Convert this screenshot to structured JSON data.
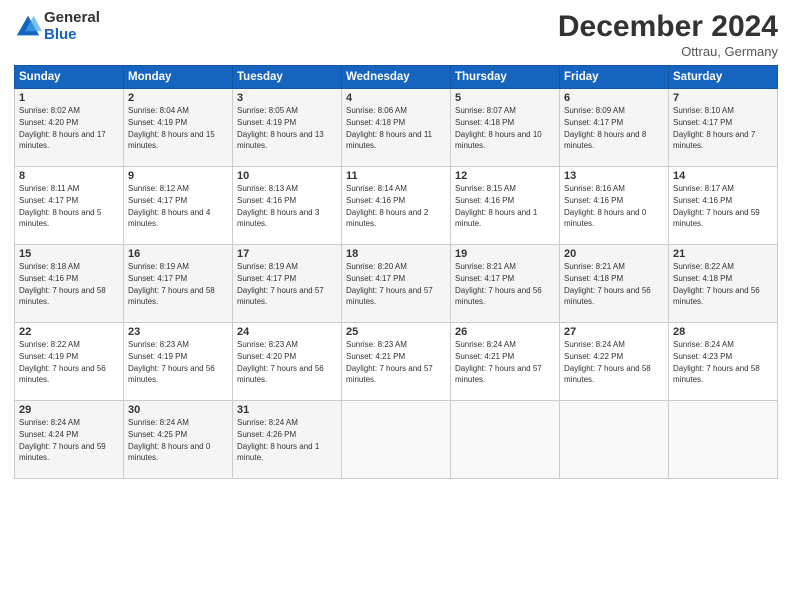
{
  "logo": {
    "general": "General",
    "blue": "Blue"
  },
  "title": "December 2024",
  "location": "Ottrau, Germany",
  "days_header": [
    "Sunday",
    "Monday",
    "Tuesday",
    "Wednesday",
    "Thursday",
    "Friday",
    "Saturday"
  ],
  "weeks": [
    [
      {
        "day": "1",
        "sunrise": "8:02 AM",
        "sunset": "4:20 PM",
        "daylight": "8 hours and 17 minutes."
      },
      {
        "day": "2",
        "sunrise": "8:04 AM",
        "sunset": "4:19 PM",
        "daylight": "8 hours and 15 minutes."
      },
      {
        "day": "3",
        "sunrise": "8:05 AM",
        "sunset": "4:19 PM",
        "daylight": "8 hours and 13 minutes."
      },
      {
        "day": "4",
        "sunrise": "8:06 AM",
        "sunset": "4:18 PM",
        "daylight": "8 hours and 11 minutes."
      },
      {
        "day": "5",
        "sunrise": "8:07 AM",
        "sunset": "4:18 PM",
        "daylight": "8 hours and 10 minutes."
      },
      {
        "day": "6",
        "sunrise": "8:09 AM",
        "sunset": "4:17 PM",
        "daylight": "8 hours and 8 minutes."
      },
      {
        "day": "7",
        "sunrise": "8:10 AM",
        "sunset": "4:17 PM",
        "daylight": "8 hours and 7 minutes."
      }
    ],
    [
      {
        "day": "8",
        "sunrise": "8:11 AM",
        "sunset": "4:17 PM",
        "daylight": "8 hours and 5 minutes."
      },
      {
        "day": "9",
        "sunrise": "8:12 AM",
        "sunset": "4:17 PM",
        "daylight": "8 hours and 4 minutes."
      },
      {
        "day": "10",
        "sunrise": "8:13 AM",
        "sunset": "4:16 PM",
        "daylight": "8 hours and 3 minutes."
      },
      {
        "day": "11",
        "sunrise": "8:14 AM",
        "sunset": "4:16 PM",
        "daylight": "8 hours and 2 minutes."
      },
      {
        "day": "12",
        "sunrise": "8:15 AM",
        "sunset": "4:16 PM",
        "daylight": "8 hours and 1 minute."
      },
      {
        "day": "13",
        "sunrise": "8:16 AM",
        "sunset": "4:16 PM",
        "daylight": "8 hours and 0 minutes."
      },
      {
        "day": "14",
        "sunrise": "8:17 AM",
        "sunset": "4:16 PM",
        "daylight": "7 hours and 59 minutes."
      }
    ],
    [
      {
        "day": "15",
        "sunrise": "8:18 AM",
        "sunset": "4:16 PM",
        "daylight": "7 hours and 58 minutes."
      },
      {
        "day": "16",
        "sunrise": "8:19 AM",
        "sunset": "4:17 PM",
        "daylight": "7 hours and 58 minutes."
      },
      {
        "day": "17",
        "sunrise": "8:19 AM",
        "sunset": "4:17 PM",
        "daylight": "7 hours and 57 minutes."
      },
      {
        "day": "18",
        "sunrise": "8:20 AM",
        "sunset": "4:17 PM",
        "daylight": "7 hours and 57 minutes."
      },
      {
        "day": "19",
        "sunrise": "8:21 AM",
        "sunset": "4:17 PM",
        "daylight": "7 hours and 56 minutes."
      },
      {
        "day": "20",
        "sunrise": "8:21 AM",
        "sunset": "4:18 PM",
        "daylight": "7 hours and 56 minutes."
      },
      {
        "day": "21",
        "sunrise": "8:22 AM",
        "sunset": "4:18 PM",
        "daylight": "7 hours and 56 minutes."
      }
    ],
    [
      {
        "day": "22",
        "sunrise": "8:22 AM",
        "sunset": "4:19 PM",
        "daylight": "7 hours and 56 minutes."
      },
      {
        "day": "23",
        "sunrise": "8:23 AM",
        "sunset": "4:19 PM",
        "daylight": "7 hours and 56 minutes."
      },
      {
        "day": "24",
        "sunrise": "8:23 AM",
        "sunset": "4:20 PM",
        "daylight": "7 hours and 56 minutes."
      },
      {
        "day": "25",
        "sunrise": "8:23 AM",
        "sunset": "4:21 PM",
        "daylight": "7 hours and 57 minutes."
      },
      {
        "day": "26",
        "sunrise": "8:24 AM",
        "sunset": "4:21 PM",
        "daylight": "7 hours and 57 minutes."
      },
      {
        "day": "27",
        "sunrise": "8:24 AM",
        "sunset": "4:22 PM",
        "daylight": "7 hours and 58 minutes."
      },
      {
        "day": "28",
        "sunrise": "8:24 AM",
        "sunset": "4:23 PM",
        "daylight": "7 hours and 58 minutes."
      }
    ],
    [
      {
        "day": "29",
        "sunrise": "8:24 AM",
        "sunset": "4:24 PM",
        "daylight": "7 hours and 59 minutes."
      },
      {
        "day": "30",
        "sunrise": "8:24 AM",
        "sunset": "4:25 PM",
        "daylight": "8 hours and 0 minutes."
      },
      {
        "day": "31",
        "sunrise": "8:24 AM",
        "sunset": "4:26 PM",
        "daylight": "8 hours and 1 minute."
      },
      null,
      null,
      null,
      null
    ]
  ]
}
